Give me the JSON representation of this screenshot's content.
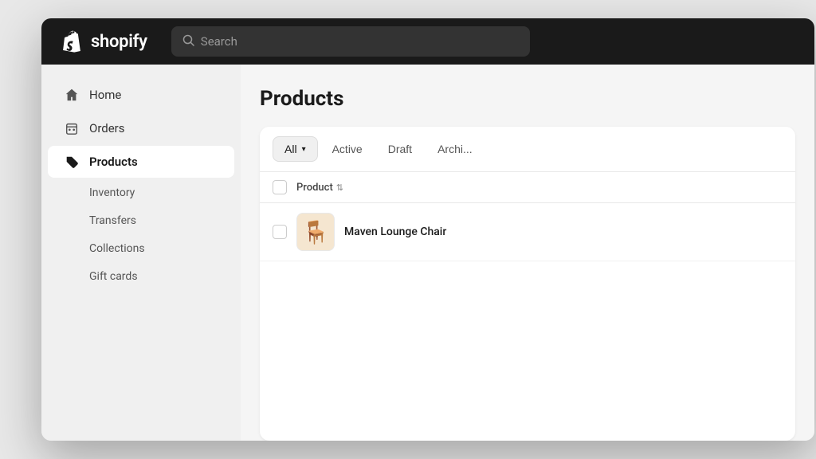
{
  "topnav": {
    "logo_text": "shopify",
    "search_placeholder": "Search"
  },
  "sidebar": {
    "nav_items": [
      {
        "id": "home",
        "label": "Home",
        "icon": "home"
      },
      {
        "id": "orders",
        "label": "Orders",
        "icon": "orders"
      },
      {
        "id": "products",
        "label": "Products",
        "icon": "tag",
        "active": true
      }
    ],
    "sub_items": [
      {
        "id": "inventory",
        "label": "Inventory"
      },
      {
        "id": "transfers",
        "label": "Transfers"
      },
      {
        "id": "collections",
        "label": "Collections"
      },
      {
        "id": "gift-cards",
        "label": "Gift cards"
      }
    ]
  },
  "content": {
    "page_title": "Products",
    "filter_tabs": [
      {
        "id": "all",
        "label": "All",
        "selected": true
      },
      {
        "id": "active",
        "label": "Active"
      },
      {
        "id": "draft",
        "label": "Draft"
      },
      {
        "id": "archived",
        "label": "Archi..."
      }
    ],
    "table": {
      "col_product": "Product",
      "rows": [
        {
          "id": "row1",
          "name": "Maven Lounge Chair",
          "emoji": "🪑"
        }
      ]
    }
  }
}
